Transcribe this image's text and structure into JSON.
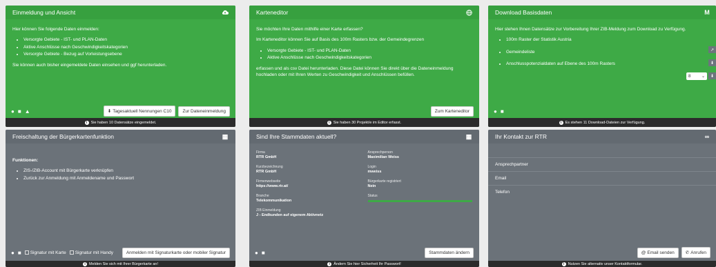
{
  "card1": {
    "title": "Einmeldung und Ansicht",
    "intro": "Hier können Sie folgende Daten einmelden:",
    "items": [
      "Versorgte Gebiete - IST- und PLAN-Daten",
      "Aktive Anschlüsse nach Geschwindigkeitskategorien",
      "Versorgte Gebiete - Bezug auf Vorleistungsebene"
    ],
    "outro": "Sie können auch bisher eingemeldete Daten einsehen und ggf herunterladen.",
    "btn_download": "Tagesaktuell Nennungen C10",
    "btn_einmeldung": "Zur Dateneinmeldung",
    "status": "Sie haben 10 Datensätze eingemeldet."
  },
  "card2": {
    "title": "Karteneditor",
    "intro": "Sie möchten Ihre Daten mithilfe einer Karte erfassen?",
    "intro2": "Im Karteneditor können Sie auf Basis des 100m Rasters bzw. der Gemeindegrenzen",
    "items": [
      "Versorgte Gebiete - IST- und PLAN-Daten",
      "Aktive Anschlüsse nach Geschwindigkeitskategorien"
    ],
    "outro": "erfassen und als csv Datei herunterladen. Diese Datei können Sie direkt über die Dateneinmeldung hochladen oder mit Ihren Werten zu Geschwindigkeit und Anschlüssen befüllen.",
    "btn": "Zum Karteneditor",
    "status": "Sie haben 30 Projekt/e im Editor erfasst."
  },
  "card3": {
    "title": "Download Basisdaten",
    "intro": "Hier stehen Ihnen Datensätze zur Vorbereitung Ihrer ZIB-Meldung zum Download zu Verfügung.",
    "items": [
      "100m Raster der Statistik Austria",
      "Gemeindeliste",
      "Anschlusspotenzialdaten auf Ebene des 100m Rasters"
    ],
    "select_value": "8",
    "status": "Es stehen 11 Download-Dateien zur Verfügung."
  },
  "card4": {
    "title": "Freischaltung der Bürgerkartenfunktion",
    "functions_label": "Funktionen:",
    "items": [
      "ZIS-/ZIB-Account mit Bürgerkarte verknüpfen",
      "Zurück zur Anmeldung mit Anmeldename und Passwort"
    ],
    "sig_karte": "Signatur mit Karte",
    "sig_handy": "Signatur mit Handy",
    "btn": "Anmelden mit Signaturkarte oder mobiler Signatur",
    "status": "Melden Sie sich mit Ihrer Bürgerkarte an!"
  },
  "card5": {
    "title": "Sind Ihre Stammdaten aktuell?",
    "fields": [
      {
        "label": "Firma",
        "value": "RTR GmbH"
      },
      {
        "label": "Ansprechperson",
        "value": "Maximilian Weiss"
      },
      {
        "label": "Kurzbezeichnung",
        "value": "RTR GmbH"
      },
      {
        "label": "Login",
        "value": "mweiss"
      },
      {
        "label": "Firmenwebseite",
        "value": "https://www.rtr.at/"
      },
      {
        "label": "Bürgerkarte registriert",
        "value": "Nein"
      },
      {
        "label": "Branche",
        "value": "Telekommunikation"
      },
      {
        "label": "Status",
        "value": ""
      }
    ],
    "zib_label": "ZIB Einmeldung",
    "zib_value": "J - Endkunden auf eigenem Aktivnetz",
    "btn": "Stammdaten ändern",
    "status": "Ändern Sie hier Sicherheit Ihr Passwort!"
  },
  "card6": {
    "title": "Ihr Kontakt zur RTR",
    "rows": [
      "Ansprechpartner",
      "Email",
      "Telefon"
    ],
    "btn_email": "Email senden",
    "btn_call": "Anrufen",
    "status": "Nutzen Sie alternativ unser Kontaktformular."
  }
}
